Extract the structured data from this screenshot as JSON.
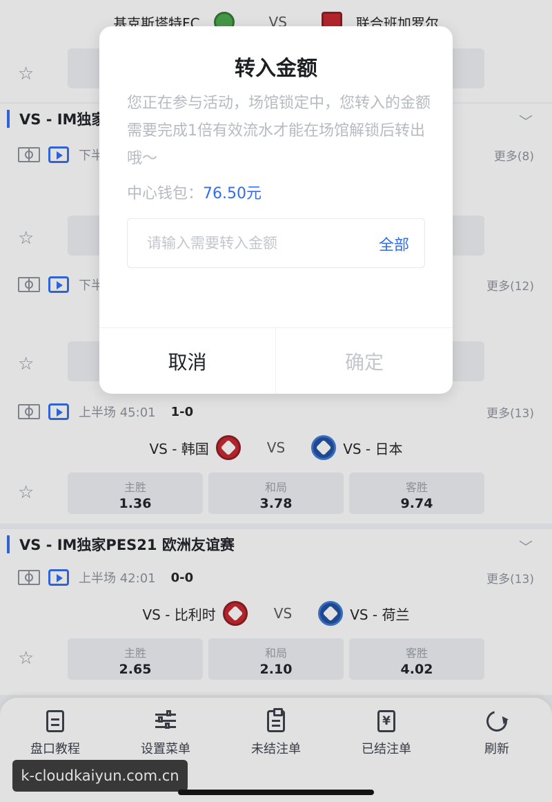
{
  "top_match": {
    "home": "基克斯塔特FC",
    "vs": "VS",
    "away": "联合班加罗尔"
  },
  "leagues": [
    {
      "name": "VS - IM独家"
    },
    {
      "name": "VS - IM独家PES21 欧洲友谊赛"
    }
  ],
  "matches": [
    {
      "time": "下半",
      "more": "更多(8)"
    },
    {
      "time": "下半",
      "more": "更多(12)"
    },
    {
      "time": "上半场 45:01",
      "score": "1-0",
      "more": "更多(13)",
      "home": "VS - 韩国",
      "vs": "VS",
      "away": "VS - 日本",
      "odds": [
        {
          "label": "主胜",
          "value": "1.36"
        },
        {
          "label": "和局",
          "value": "3.78"
        },
        {
          "label": "客胜",
          "value": "9.74"
        }
      ]
    },
    {
      "time": "上半场 42:01",
      "score": "0-0",
      "more": "更多(13)",
      "home": "VS - 比利时",
      "vs": "VS",
      "away": "VS - 荷兰",
      "odds": [
        {
          "label": "主胜",
          "value": "2.65"
        },
        {
          "label": "和局",
          "value": "2.10"
        },
        {
          "label": "客胜",
          "value": "4.02"
        }
      ]
    }
  ],
  "tabbar": [
    {
      "label": "盘口教程",
      "icon": "document-icon"
    },
    {
      "label": "设置菜单",
      "icon": "sliders-icon"
    },
    {
      "label": "未结注单",
      "icon": "clipboard-icon"
    },
    {
      "label": "已结注单",
      "icon": "yen-receipt-icon"
    },
    {
      "label": "刷新",
      "icon": "refresh-icon"
    }
  ],
  "watermark": "k-cloudkaiyun.com.cn",
  "dialog": {
    "title": "转入金额",
    "message": "您正在参与活动，场馆锁定中，您转入的金额需要完成1倍有效流水才能在场馆解锁后转出哦～",
    "wallet_label": "中心钱包：",
    "wallet_amount": "76.50元",
    "input_placeholder": "请输入需要转入金额",
    "all_label": "全部",
    "cancel_label": "取消",
    "confirm_label": "确定"
  },
  "colors": {
    "accent": "#2f6cf0",
    "disabled": "#c3c7cd"
  }
}
